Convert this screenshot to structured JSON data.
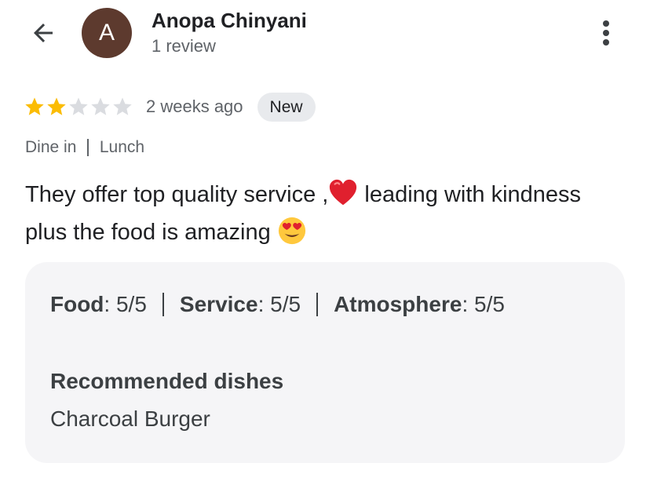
{
  "author": {
    "initial": "A",
    "name": "Anopa Chinyani",
    "review_count": "1 review",
    "avatar_color": "#5d3a2e"
  },
  "toolbar": {
    "back_icon": "arrow-left-icon",
    "more_icon": "more-vertical-icon"
  },
  "review": {
    "rating": 2,
    "max_rating": 5,
    "time_ago": "2 weeks ago",
    "badge": "New",
    "meta": [
      "Dine in",
      "Lunch"
    ],
    "text_part1": "They offer top quality service ,",
    "text_part2": " leading with kindness plus the food is amazing ",
    "emojis": [
      "red-heart-emoji",
      "heart-eyes-emoji"
    ]
  },
  "details": {
    "scores": [
      {
        "label": "Food",
        "value": "5/5"
      },
      {
        "label": "Service",
        "value": "5/5"
      },
      {
        "label": "Atmosphere",
        "value": "5/5"
      }
    ],
    "recommended_title": "Recommended dishes",
    "recommended_value": "Charcoal Burger"
  },
  "colors": {
    "star_filled": "#fbbc04",
    "star_empty": "#dadce0",
    "heart": "#e0202e",
    "emoji_face": "#ffc83d"
  }
}
